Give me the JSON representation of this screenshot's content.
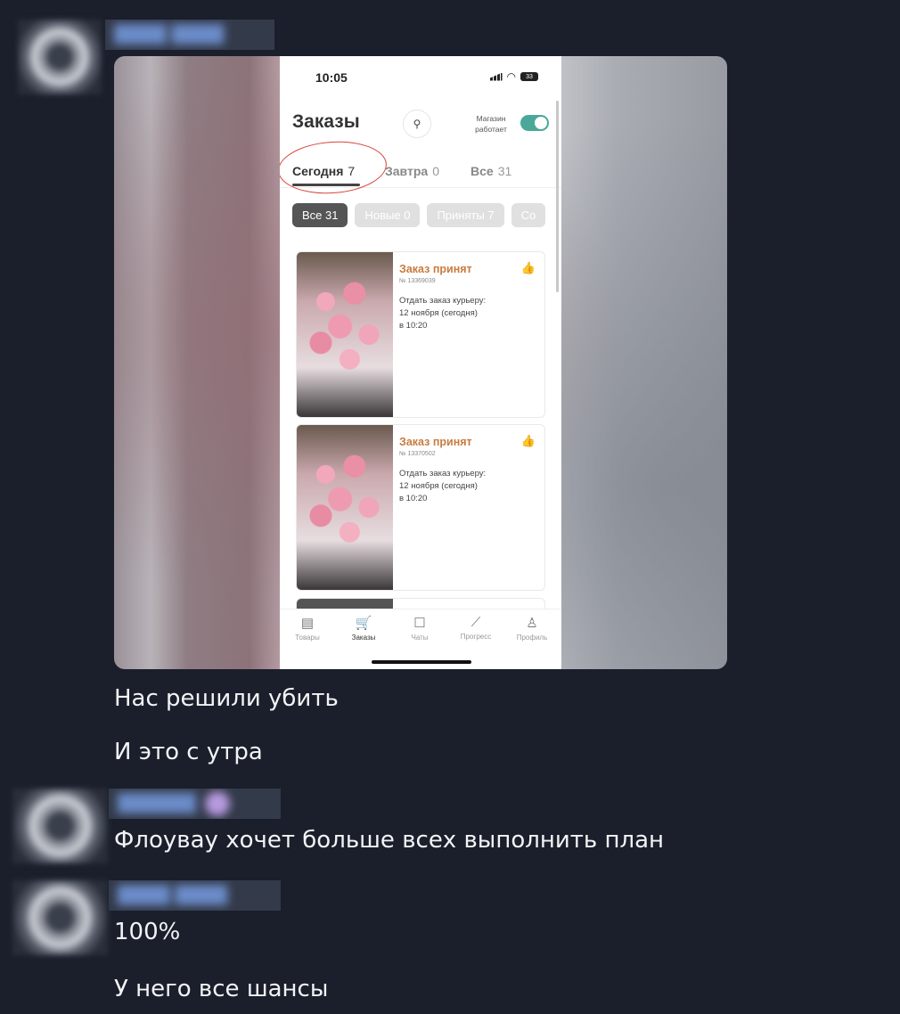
{
  "chat": {
    "messages": [
      {
        "text": "Нас решили убить"
      },
      {
        "text": "И это с утра"
      },
      {
        "text": "Флоувау хочет больше всех выполнить план"
      },
      {
        "text": "100%"
      },
      {
        "text": "У него все шансы"
      }
    ]
  },
  "screenshot": {
    "status_time": "10:05",
    "battery": "33",
    "title": "Заказы",
    "shop_status_label": "Магазин работает",
    "tabs": [
      {
        "label": "Сегодня",
        "count": "7"
      },
      {
        "label": "Завтра",
        "count": "0"
      },
      {
        "label": "Все",
        "count": "31"
      }
    ],
    "chips": [
      "Все 31",
      "Новые 0",
      "Приняты 7",
      "Со"
    ],
    "orders": [
      {
        "status": "Заказ принят",
        "number": "№ 13369039",
        "line1": "Отдать заказ курьеру:",
        "line2": "12 ноября (сегодня)",
        "line3": "в 10:20"
      },
      {
        "status": "Заказ принят",
        "number": "№ 13370502",
        "line1": "Отдать заказ курьеру:",
        "line2": "12 ноября (сегодня)",
        "line3": "в 10:20"
      }
    ],
    "nav": [
      "Товары",
      "Заказы",
      "Чаты",
      "Прогресс",
      "Профиль"
    ]
  },
  "colors": {
    "background": "#1b1f2b",
    "accent_orange": "#c97b3e",
    "toggle_teal": "#4aa89a",
    "annotation_red": "#d9443c"
  }
}
